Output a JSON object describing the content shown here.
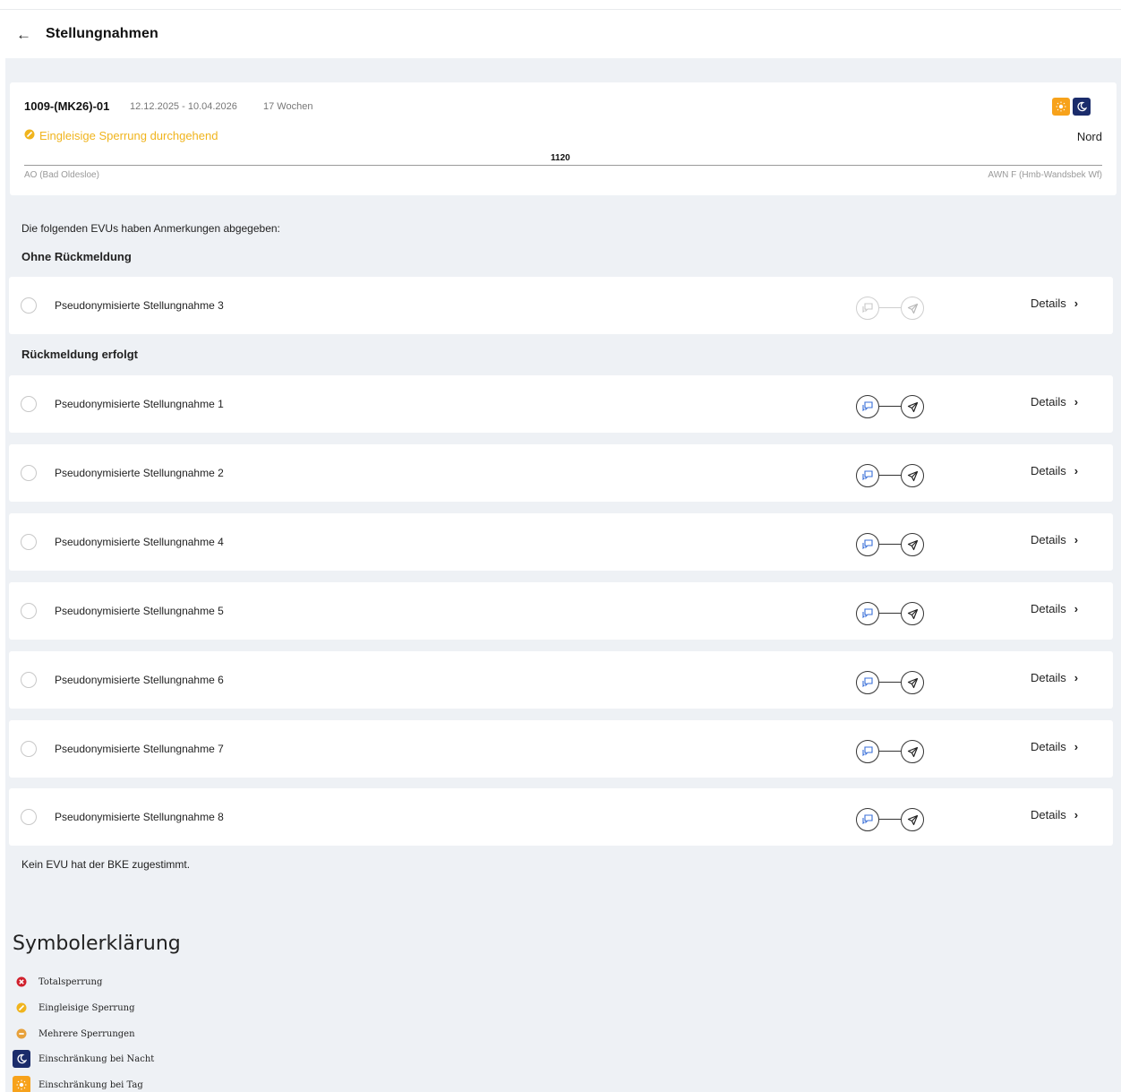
{
  "header": {
    "back_icon": "arrow-left-icon",
    "title": "Stellungnahmen"
  },
  "info": {
    "id": "1009-(MK26)-01",
    "dates": "12.12.2025 - 10.04.2026",
    "weeks": "17 Wochen",
    "sperrung": "Eingleisige Sperrung durchgehend",
    "region": "Nord",
    "km": "1120",
    "station_from": "AO (Bad Oldesloe)",
    "station_to": "AWN F (Hmb-Wandsbek Wf)",
    "badges": [
      "sun-icon",
      "moon-icon"
    ],
    "colors": {
      "sperrung": "#f0b41d",
      "sun": "#f7a21b",
      "moon": "#1b2c6b"
    }
  },
  "intro": "Die folgenden EVUs haben Anmerkungen abgegeben:",
  "sections": {
    "ohne": {
      "title": "Ohne Rückmeldung",
      "items": [
        {
          "label": "Pseudonymisierte Stellungnahme 3",
          "details": "Details"
        }
      ]
    },
    "erfolgt": {
      "title": "Rückmeldung erfolgt",
      "items": [
        {
          "label": "Pseudonymisierte Stellungnahme 1",
          "details": "Details"
        },
        {
          "label": "Pseudonymisierte Stellungnahme 2",
          "details": "Details"
        },
        {
          "label": "Pseudonymisierte Stellungnahme 4",
          "details": "Details"
        },
        {
          "label": "Pseudonymisierte Stellungnahme 5",
          "details": "Details"
        },
        {
          "label": "Pseudonymisierte Stellungnahme 6",
          "details": "Details"
        },
        {
          "label": "Pseudonymisierte Stellungnahme 7",
          "details": "Details"
        },
        {
          "label": "Pseudonymisierte Stellungnahme 8",
          "details": "Details"
        }
      ]
    }
  },
  "no_agree": "Kein EVU hat der BKE zugestimmt.",
  "legend": {
    "title": "Symbolerklärung",
    "items": [
      {
        "label": "Totalsperrung",
        "icon": "total-closure-icon",
        "color": "#d0202c"
      },
      {
        "label": "Eingleisige Sperrung",
        "icon": "single-track-closure-icon",
        "color": "#f0b41d"
      },
      {
        "label": "Mehrere Sperrungen",
        "icon": "multiple-closures-icon",
        "color": "#e7a13b"
      },
      {
        "label": "Einschränkung bei Nacht",
        "icon": "moon-icon",
        "color": "#1b2c6b"
      },
      {
        "label": "Einschränkung bei Tag",
        "icon": "sun-icon",
        "color": "#f7a21b"
      }
    ]
  }
}
